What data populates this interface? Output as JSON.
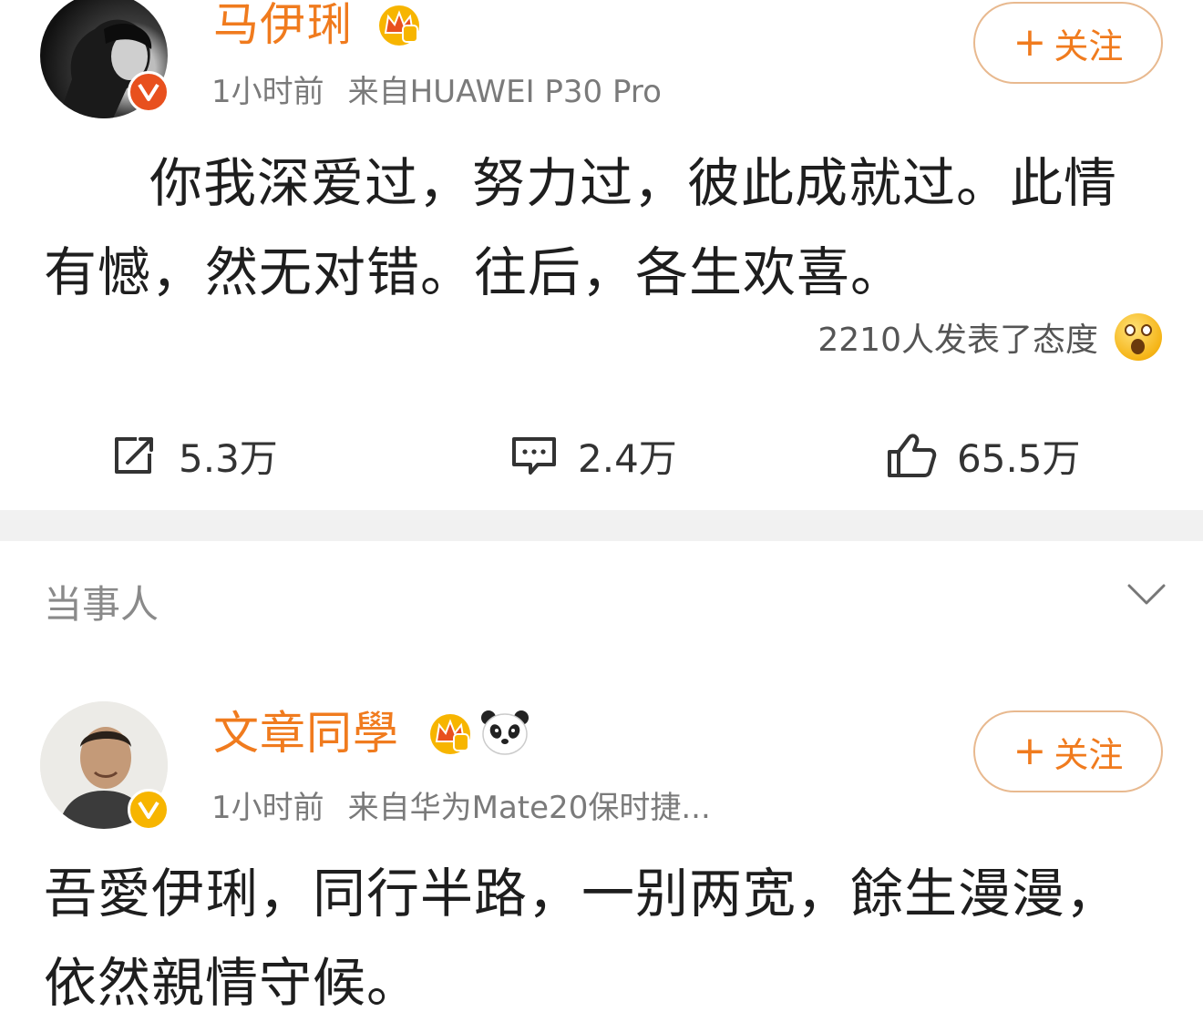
{
  "post1": {
    "username": "马伊琍",
    "time": "1小时前",
    "source": "来自HUAWEI P30 Pro",
    "follow_label": "关注",
    "text_line1": "你我深爱过，努力过，彼此成就过。此情",
    "text_line2": "有憾，然无对错。往后，各生欢喜。",
    "reaction_text": "2210人发表了态度",
    "reaction_icon": "wow-emoji-icon",
    "repost_count": "5.3万",
    "comment_count": "2.4万",
    "like_count": "65.5万"
  },
  "section": {
    "title": "当事人"
  },
  "post2": {
    "username": "文章同學",
    "time": "1小时前",
    "source": "来自华为Mate20保时捷...",
    "follow_label": "关注",
    "text_line1": "吾愛伊琍，同行半路，一别两宽，餘生漫漫，",
    "text_line2": "依然親情守候。"
  },
  "colors": {
    "username": "#f07b1e",
    "meta": "#7a7a7a",
    "follow_border": "#e8b98f",
    "badge_red": "#e8501e",
    "badge_gold": "#f7b500"
  }
}
